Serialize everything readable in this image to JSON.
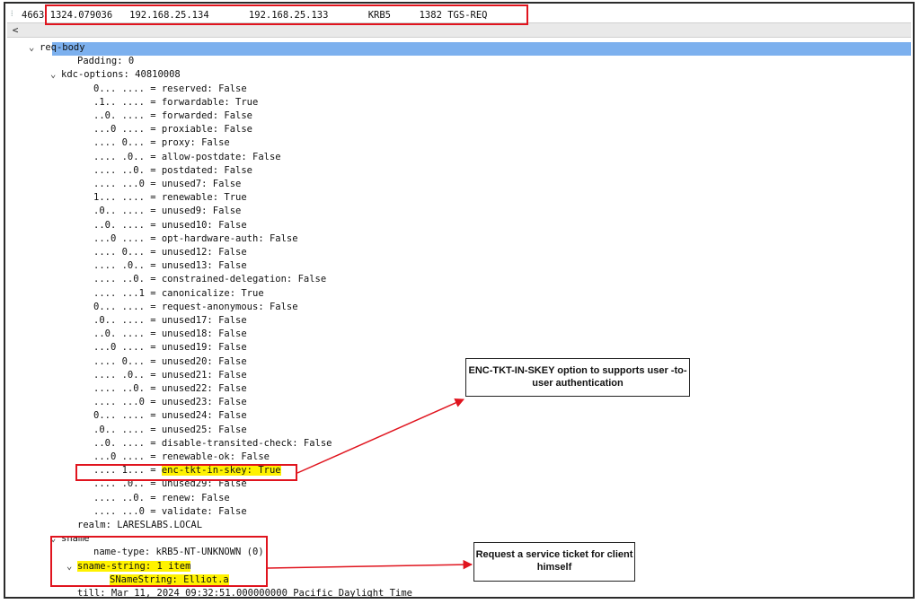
{
  "packet": {
    "number": "4663",
    "time": "1324.079036",
    "source": "192.168.25.134",
    "destination": "192.168.25.133",
    "protocol": "KRB5",
    "length": "1382",
    "info": "TGS-REQ"
  },
  "scroll_left_label": "<",
  "tree": {
    "req_body": "req-body",
    "padding": "Padding: 0",
    "kdc_options": "kdc-options: 40810008",
    "flags": [
      "0... .... = reserved: False",
      ".1.. .... = forwardable: True",
      "..0. .... = forwarded: False",
      "...0 .... = proxiable: False",
      ".... 0... = proxy: False",
      ".... .0.. = allow-postdate: False",
      ".... ..0. = postdated: False",
      ".... ...0 = unused7: False",
      "1... .... = renewable: True",
      ".0.. .... = unused9: False",
      "..0. .... = unused10: False",
      "...0 .... = opt-hardware-auth: False",
      ".... 0... = unused12: False",
      ".... .0.. = unused13: False",
      ".... ..0. = constrained-delegation: False",
      ".... ...1 = canonicalize: True",
      "0... .... = request-anonymous: False",
      ".0.. .... = unused17: False",
      "..0. .... = unused18: False",
      "...0 .... = unused19: False",
      ".... 0... = unused20: False",
      ".... .0.. = unused21: False",
      ".... ..0. = unused22: False",
      ".... ...0 = unused23: False",
      "0... .... = unused24: False",
      ".0.. .... = unused25: False",
      "..0. .... = disable-transited-check: False",
      "...0 .... = renewable-ok: False"
    ],
    "enc_tkt_prefix": ".... 1... = ",
    "enc_tkt_value": "enc-tkt-in-skey: True",
    "flags_after": [
      ".... .0.. = unused29: False",
      ".... ..0. = renew: False",
      ".... ...0 = validate: False"
    ],
    "realm": "realm: LARESLABS.LOCAL",
    "sname": "sname",
    "name_type": "name-type: kRB5-NT-UNKNOWN (0)",
    "sname_string": "sname-string: 1 item",
    "sname_string_value": "SNameString: Elliot.a",
    "till": "till: Mar 11, 2024 09:32:51.000000000 Pacific Daylight Time"
  },
  "callouts": {
    "enc_tkt": "ENC-TKT-IN-SKEY option to supports user -to-user authentication",
    "service_ticket": "Request a service ticket for client himself"
  },
  "colors": {
    "highlight": "#fff200",
    "selection": "#7cb0ee",
    "annotation_red": "#e0141e"
  }
}
